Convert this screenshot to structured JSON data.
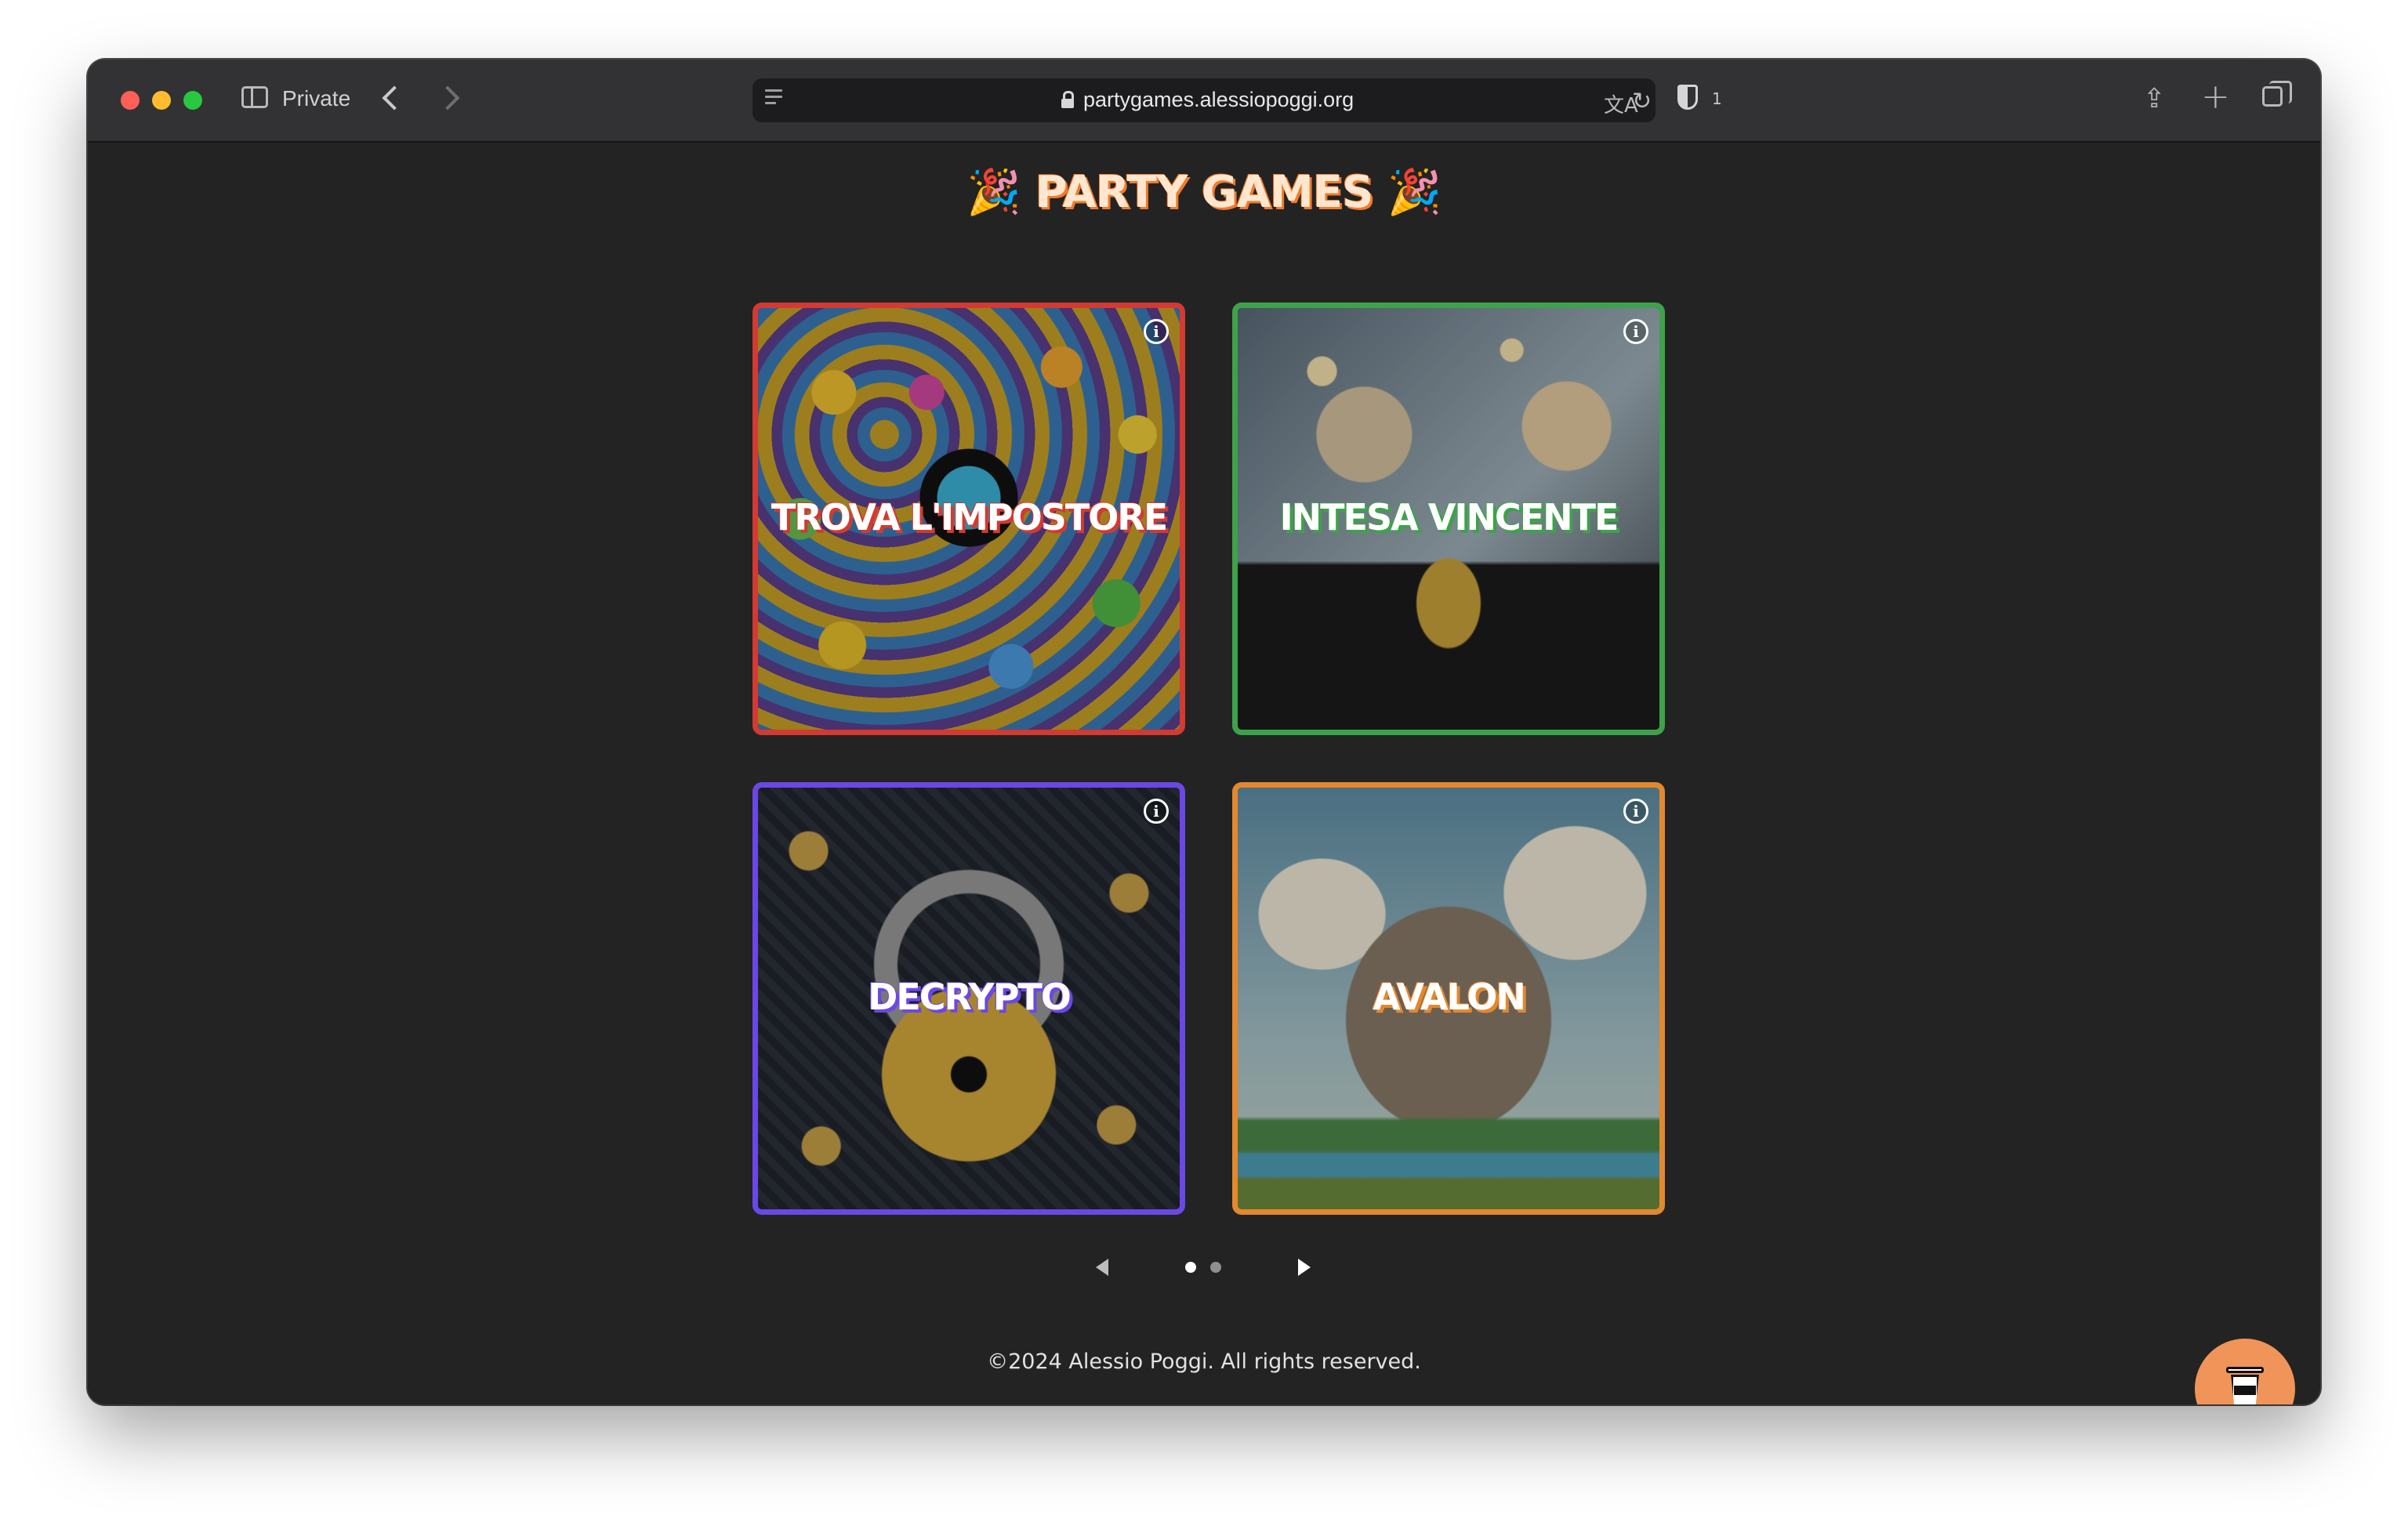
{
  "browser": {
    "mode_label": "Private",
    "url": "partygames.alessiopoggi.org",
    "shield_count": "1"
  },
  "page": {
    "title_emoji": "🎉",
    "title": "PARTY GAMES",
    "games": [
      {
        "name": "TROVA L'IMPOSTORE",
        "accent": "#d23a32"
      },
      {
        "name": "INTESA VINCENTE",
        "accent": "#3ea24a"
      },
      {
        "name": "DECRYPTO",
        "accent": "#6b47e6"
      },
      {
        "name": "AVALON",
        "accent": "#e3882f"
      }
    ],
    "pager": {
      "current_page": 1,
      "total_pages": 2
    },
    "footer": "©2024 Alessio Poggi. All rights reserved."
  },
  "icons": {
    "info": "i",
    "translate": "文A",
    "reload": "↻",
    "share": "⇪",
    "plus": "+"
  }
}
